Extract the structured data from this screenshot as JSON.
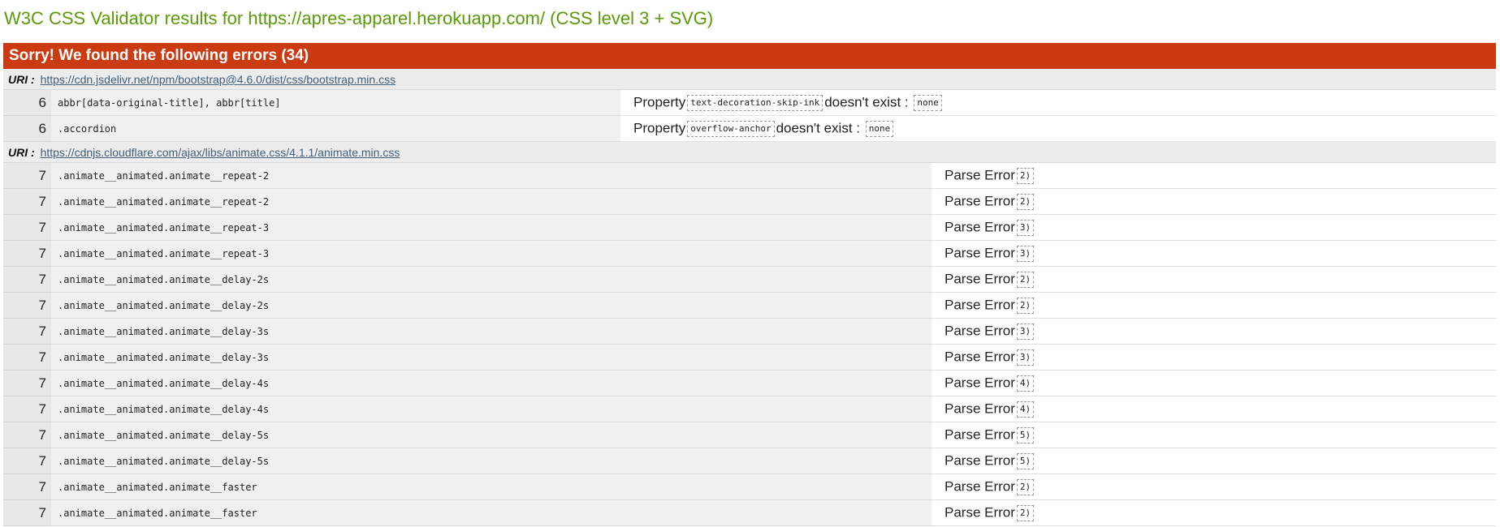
{
  "page": {
    "title": "W3C CSS Validator results for https://apres-apparel.herokuapp.com/ (CSS level 3 + SVG)"
  },
  "errors": {
    "header": "Sorry! We found the following errors (34)",
    "uri_label": "URI :",
    "groups": [
      {
        "uri": "https://cdn.jsdelivr.net/npm/bootstrap@4.6.0/dist/css/bootstrap.min.css",
        "rows": [
          {
            "line": "6",
            "context": "abbr[data-original-title], abbr[title]",
            "msg_prefix": "Property",
            "code": "text-decoration-skip-ink",
            "msg_suffix": "doesn't exist :",
            "value": "none"
          },
          {
            "line": "6",
            "context": ".accordion",
            "msg_prefix": "Property",
            "code": "overflow-anchor",
            "msg_suffix": "doesn't exist :",
            "value": "none"
          }
        ]
      },
      {
        "uri": "https://cdnjs.cloudflare.com/ajax/libs/animate.css/4.1.1/animate.min.css",
        "rows": [
          {
            "line": "7",
            "context": ".animate__animated.animate__repeat-2",
            "msg_prefix": "Parse Error",
            "code": "2)"
          },
          {
            "line": "7",
            "context": ".animate__animated.animate__repeat-2",
            "msg_prefix": "Parse Error",
            "code": "2)"
          },
          {
            "line": "7",
            "context": ".animate__animated.animate__repeat-3",
            "msg_prefix": "Parse Error",
            "code": "3)"
          },
          {
            "line": "7",
            "context": ".animate__animated.animate__repeat-3",
            "msg_prefix": "Parse Error",
            "code": "3)"
          },
          {
            "line": "7",
            "context": ".animate__animated.animate__delay-2s",
            "msg_prefix": "Parse Error",
            "code": "2)"
          },
          {
            "line": "7",
            "context": ".animate__animated.animate__delay-2s",
            "msg_prefix": "Parse Error",
            "code": "2)"
          },
          {
            "line": "7",
            "context": ".animate__animated.animate__delay-3s",
            "msg_prefix": "Parse Error",
            "code": "3)"
          },
          {
            "line": "7",
            "context": ".animate__animated.animate__delay-3s",
            "msg_prefix": "Parse Error",
            "code": "3)"
          },
          {
            "line": "7",
            "context": ".animate__animated.animate__delay-4s",
            "msg_prefix": "Parse Error",
            "code": "4)"
          },
          {
            "line": "7",
            "context": ".animate__animated.animate__delay-4s",
            "msg_prefix": "Parse Error",
            "code": "4)"
          },
          {
            "line": "7",
            "context": ".animate__animated.animate__delay-5s",
            "msg_prefix": "Parse Error",
            "code": "5)"
          },
          {
            "line": "7",
            "context": ".animate__animated.animate__delay-5s",
            "msg_prefix": "Parse Error",
            "code": "5)"
          },
          {
            "line": "7",
            "context": ".animate__animated.animate__faster",
            "msg_prefix": "Parse Error",
            "code": "2)"
          },
          {
            "line": "7",
            "context": ".animate__animated.animate__faster",
            "msg_prefix": "Parse Error",
            "code": "2)"
          }
        ]
      }
    ]
  },
  "colors": {
    "title_green": "#5a9a08",
    "header_red": "#cc3a11",
    "uri_link": "#41607c"
  }
}
